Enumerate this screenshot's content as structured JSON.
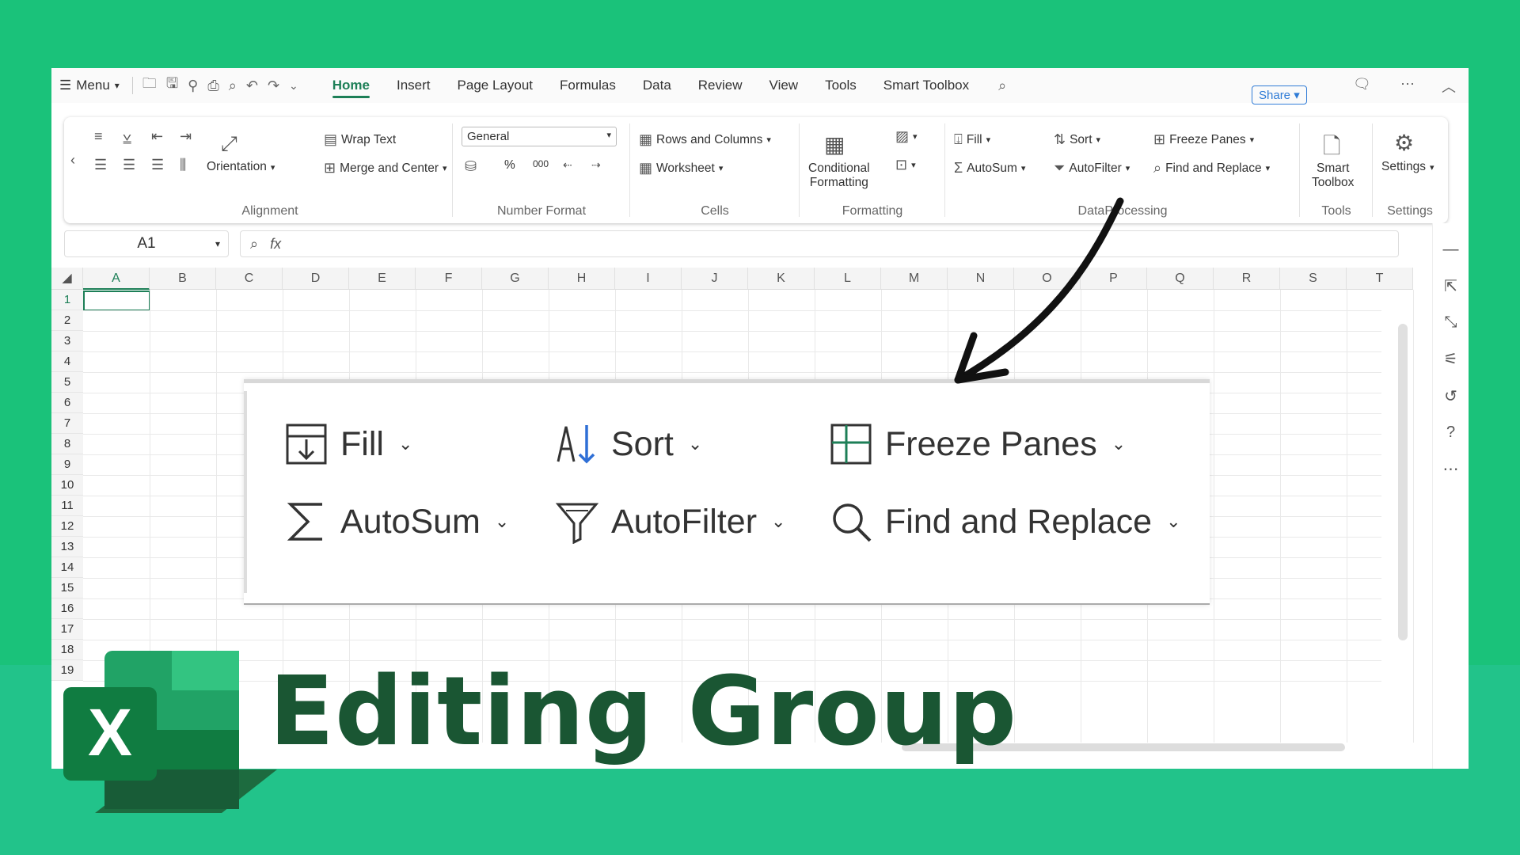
{
  "menubar": {
    "menu_label": "Menu",
    "tabs": [
      "Home",
      "Insert",
      "Page Layout",
      "Formulas",
      "Data",
      "Review",
      "View",
      "Tools",
      "Smart Toolbox"
    ],
    "share_label": "Share"
  },
  "ribbon": {
    "alignment": {
      "wrap_text": "Wrap Text",
      "merge_center": "Merge and Center",
      "orientation": "Orientation",
      "title": "Alignment"
    },
    "number_format": {
      "format_value": "General",
      "percent": "%",
      "thousands": "000",
      "title": "Number Format"
    },
    "cells": {
      "rows_columns": "Rows and Columns",
      "worksheet": "Worksheet",
      "title": "Cells"
    },
    "formatting": {
      "conditional": "Conditional",
      "conditional2": "Formatting",
      "title": "Formatting"
    },
    "data_processing": {
      "fill": "Fill",
      "sort": "Sort",
      "freeze": "Freeze Panes",
      "autosum": "AutoSum",
      "autofilter": "AutoFilter",
      "find_replace": "Find and Replace",
      "title": "DataProcessing"
    },
    "tools": {
      "smart1": "Smart",
      "smart2": "Toolbox",
      "title": "Tools"
    },
    "settings": {
      "label": "Settings",
      "title": "Settings"
    }
  },
  "formula_bar": {
    "name_box": "A1",
    "fx": "fx"
  },
  "columns": [
    "A",
    "B",
    "C",
    "D",
    "E",
    "F",
    "G",
    "H",
    "I",
    "J",
    "K",
    "L",
    "M",
    "N",
    "O",
    "P",
    "Q",
    "R",
    "S",
    "T"
  ],
  "rows": [
    "1",
    "2",
    "3",
    "4",
    "5",
    "6",
    "7",
    "8",
    "9",
    "10",
    "11",
    "12",
    "13",
    "14",
    "15",
    "16",
    "17",
    "18",
    "19"
  ],
  "zoom_panel": {
    "fill": "Fill",
    "sort": "Sort",
    "freeze": "Freeze Panes",
    "autosum": "AutoSum",
    "autofilter": "AutoFilter",
    "find_replace": "Find and Replace"
  },
  "headline": "Editing Group",
  "logo_letter": "X",
  "colors": {
    "background": "#1ac27a",
    "accent": "#1d7f57",
    "headline": "#1a5633"
  }
}
